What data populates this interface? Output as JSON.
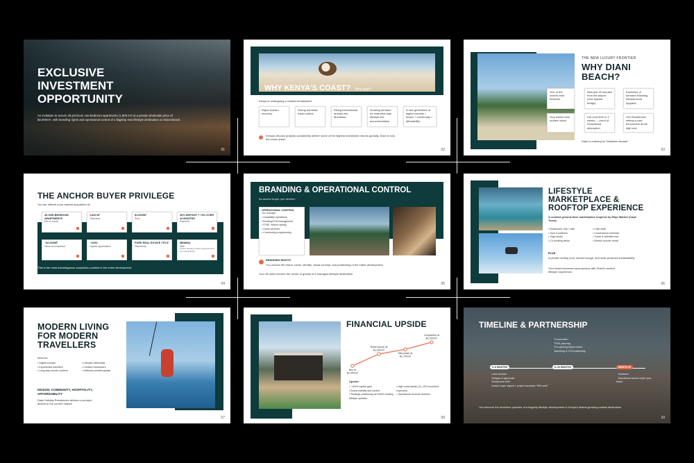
{
  "slides": {
    "s1": {
      "title_l1": "EXCLUSIVE",
      "title_l2": "INVESTMENT",
      "title_l3": "OPPORTUNITY",
      "body": "An invitation to secure 28 premium one-bedroom apartments (1,800 m²) at a private wholesale price of $3,000/m², with branding rights and operational control of a flagship new lifestyle destination on Diani Beach.",
      "num": "01"
    },
    "s2": {
      "title": "WHY KENYA'S COAST?",
      "subtitle": "Why now?",
      "intro": "Kenya is undergoing a coastal renaissance:",
      "cards": [
        "Rapid tourism recovery",
        "Strong domestic travel culture",
        "Rising international arrivals into Mombasa",
        "Growing demand for extended-stay lifestyle-led accommodation",
        "A new generation of digital nomads + beach + community + affordability"
      ],
      "note": "Kenyan off-plan projects consistently deliver some of the highest investment returns globally. Diani is now the crown jewel.",
      "num": "02"
    },
    "s3": {
      "kicker": "THE NEW LUXURY FRONTIER",
      "title_l1": "WHY DIANI",
      "title_l2": "BEACH?",
      "cards": [
        "One of the world's best beaches",
        "New just 40 minutes from the airport (new bypass bridge)",
        "Explosion of demand following infrastructure upgrade",
        "Very limited new modern stock",
        "KAI sold 90% in 3 weeks — proof of exceptional absorption",
        "100 Residences setting a new benchmark at the high end"
      ],
      "footer": "Diani is entering its \"Maldives decade\".",
      "num": "03"
    },
    "s4": {
      "title": "THE ANCHOR BUYER PRIVILEGE",
      "intro": "You are offered a pre-market acquisition of:",
      "stats": [
        {
          "v": "28 ONE-BEDROOM APARTMENTS",
          "l": "(65 m² each)"
        },
        {
          "v": "1,820 M²",
          "l": "Total area"
        },
        {
          "v": "$1,000/M²",
          "l": "Price"
        },
        {
          "v": "30% DEPOSIT + 70% OVER 24 MONTHS",
          "l": "Payment"
        },
        {
          "v": "~$2,000/M²",
          "l": "Value at completion"
        },
        {
          "v": "~100%",
          "l": "Capital appreciation"
        },
        {
          "v": "PURE REAL ESTATE TITLE",
          "l": "Ownership"
        },
        {
          "v": "MINIMAL",
          "l": "Risk"
        }
      ],
      "risk_note": "project already funded, approved and pre-sold globally",
      "footer": "This is the most advantageous acquisition position in the entire development.",
      "num": "04"
    },
    "s5": {
      "title": "BRANDING & OPERATIONAL CONTROL",
      "intro": "As anchor buyer, you receive:",
      "box_title": "OPERATIONAL CONTROL",
      "box_sub": "You manage:",
      "items": [
        "Hospitality operations",
        "Booking/OTA management",
        "FF&E, interior styling",
        "Guest services",
        "Community programming"
      ],
      "rights_title": "BRANDING RIGHTS",
      "rights_body": "You choose the brand, name, identity, visual concept, and positioning of the entire development.",
      "footer": "Your 28 units become the centre of gravity of a managed lifestyle destination.",
      "num": "05"
    },
    "s6": {
      "title_l1": "LIFESTYLE",
      "title_l2": "MARKETPLACE &",
      "title_l3": "ROOFTOP EXPERIENCE",
      "intro": "A curated ground-floor marketplace inspired by Mojo Market (Cape Town):",
      "col1": [
        "Restaurant / bar / café",
        "Gym & wellness",
        "Yoga studio",
        "Co-working desks"
      ],
      "col2": [
        "Craft retail",
        "Convenience minimart",
        "Travel & activities hub",
        "Electric scooter rental"
      ],
      "plus_title": "PLUS",
      "plus_body": "A private rooftop pool, sunset lounge, and solar-powered sustainability.",
      "footer": "Your brand becomes synonymous with Diani's modern lifestyle experience.",
      "num": "06"
    },
    "s7": {
      "title_l1": "MODERN LIVING",
      "title_l2": "FOR MODERN",
      "title_l3": "TRAVELLERS",
      "ideal": "Ideal for:",
      "col1": [
        "Digital nomads",
        "Experiential travellers",
        "Long-stay remote workers"
      ],
      "col2": [
        "Lifestyle millennials",
        "Creative freelancers",
        "Wellness-minded guests"
      ],
      "tagline": "DESIGN, COMMUNITY, HOSPITALITY, AFFORDABILITY",
      "footer": "Diani Holiday Residences delivers a product absent in the current market",
      "num": "07"
    },
    "s9": {
      "title": "FINANCIAL UPSIDE",
      "points": [
        {
          "label": "Buy at",
          "value": "$1,000/m²"
        },
        {
          "label": "Retail launch at",
          "value": "$1,500/m²"
        },
        {
          "label": "Mid-phase at",
          "value": "$1,700/m²"
        },
        {
          "label": "Completion at",
          "value": "$2,000/m²"
        }
      ],
      "upside": "Upside:",
      "col1": [
        "~100% capital gain",
        "Brand visibility and control",
        "Strategic positioning as Diani's leading lifestyle operator"
      ],
      "col2": [
        "High rental yields (12–15% furnished expected)",
        "Operational revenue streams"
      ],
      "num": "09"
    },
    "s10": {
      "title": "TIMELINE & PARTNERSHIP",
      "top": [
        "Construction",
        "FF&E planning",
        "Pre-opening brand rollout",
        "Marketing & OTA positioning"
      ],
      "phases": [
        "0–6 MONTHS",
        "6–30 MONTHS",
        "MONTH 30"
      ],
      "p1": [
        "Land secured",
        "Designs & approvals",
        "Showhouse built",
        "Anchor buyer signed + project launches \"99% sold\""
      ],
      "p3": [
        "Handover",
        "Operational launch under your brand"
      ],
      "footer": "You become the exclusive operator of a flagship lifestyle development in Kenya's fastest growing coastal destination.",
      "num": "10"
    }
  },
  "colors": {
    "teal": "#0e3b3b",
    "accent": "#e46a4a",
    "background": "#000000"
  }
}
